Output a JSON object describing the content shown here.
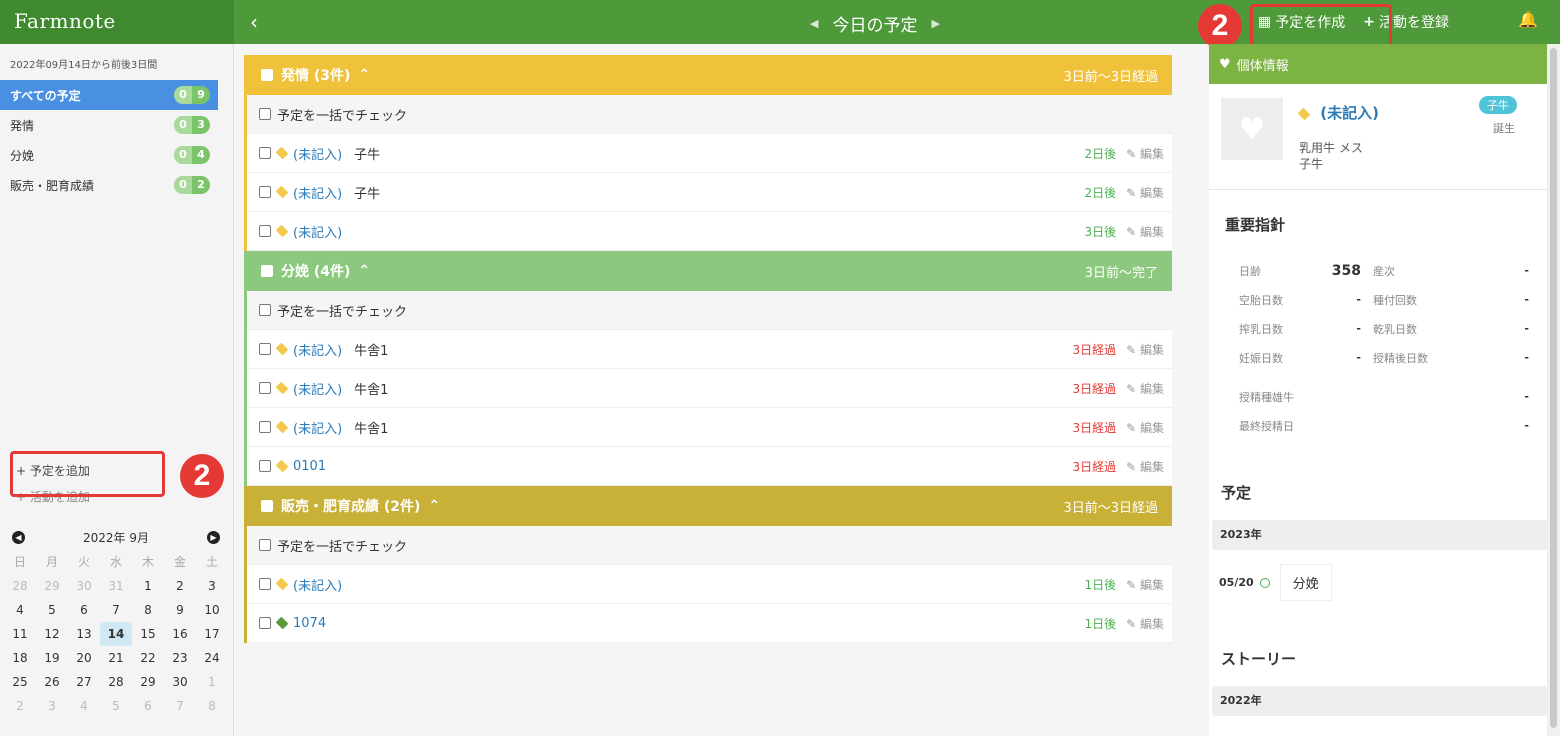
{
  "app": {
    "logo": "Farmnote",
    "back_icon": "chevron-left-icon"
  },
  "header": {
    "title": "今日の予定",
    "create_plan": "予定を作成",
    "register_activity": "活動を登録",
    "marker": "2"
  },
  "sidebar": {
    "range": "2022年09月14日から前後3日間",
    "items": [
      {
        "label": "すべての予定",
        "count": [
          "0",
          "9"
        ],
        "active": true
      },
      {
        "label": "発情",
        "count": [
          "0",
          "3"
        ]
      },
      {
        "label": "分娩",
        "count": [
          "0",
          "4"
        ]
      },
      {
        "label": "販売・肥育成績",
        "count": [
          "0",
          "2"
        ]
      }
    ],
    "add_plan": "+ 予定を追加",
    "add_activity": "+ 活動を追加",
    "marker": "2"
  },
  "calendar": {
    "month": "2022年 9月",
    "dow": [
      "日",
      "月",
      "火",
      "水",
      "木",
      "金",
      "土"
    ],
    "weeks": [
      [
        "28",
        "29",
        "30",
        "31",
        "1",
        "2",
        "3"
      ],
      [
        "4",
        "5",
        "6",
        "7",
        "8",
        "9",
        "10"
      ],
      [
        "11",
        "12",
        "13",
        "14",
        "15",
        "16",
        "17"
      ],
      [
        "18",
        "19",
        "20",
        "21",
        "22",
        "23",
        "24"
      ],
      [
        "25",
        "26",
        "27",
        "28",
        "29",
        "30",
        "1"
      ],
      [
        "2",
        "3",
        "4",
        "5",
        "6",
        "7",
        "8"
      ]
    ],
    "today": "14"
  },
  "groups": [
    {
      "title": "発情 (3件)",
      "range": "3日前〜3日経過",
      "color": "#f0c13a",
      "bulk": "予定を一括でチェック",
      "rows": [
        {
          "id": "(未記入)",
          "note": "子牛",
          "due": "2日後",
          "due_type": "green",
          "tag": "#f2c94c"
        },
        {
          "id": "(未記入)",
          "note": "子牛",
          "due": "2日後",
          "due_type": "green",
          "tag": "#f2c94c"
        },
        {
          "id": "(未記入)",
          "note": "",
          "due": "3日後",
          "due_type": "green",
          "tag": "#f2c94c"
        }
      ]
    },
    {
      "title": "分娩 (4件)",
      "range": "3日前〜完了",
      "color": "#8cc97e",
      "bulk": "予定を一括でチェック",
      "rows": [
        {
          "id": "(未記入)",
          "note": "牛舎1",
          "due": "3日経過",
          "due_type": "red",
          "tag": "#f2c94c"
        },
        {
          "id": "(未記入)",
          "note": "牛舎1",
          "due": "3日経過",
          "due_type": "red",
          "tag": "#f2c94c"
        },
        {
          "id": "(未記入)",
          "note": "牛舎1",
          "due": "3日経過",
          "due_type": "red",
          "tag": "#f2c94c"
        },
        {
          "id": "0101",
          "note": "",
          "due": "3日経過",
          "due_type": "red",
          "tag": "#f2c94c"
        }
      ]
    },
    {
      "title": "販売・肥育成績 (2件)",
      "range": "3日前〜3日経過",
      "color": "#c9b036",
      "bulk": "予定を一括でチェック",
      "rows": [
        {
          "id": "(未記入)",
          "note": "",
          "due": "1日後",
          "due_type": "green",
          "tag": "#f2c94c"
        },
        {
          "id": "1074",
          "note": "",
          "due": "1日後",
          "due_type": "green",
          "tag": "#5b9a3c"
        }
      ]
    }
  ],
  "edit_label": "編集",
  "cow": {
    "panel_title": "個体情報",
    "name": "(未記入)",
    "badge": "子牛",
    "birth": "誕生",
    "breed": "乳用牛 メス",
    "stage": "子牛"
  },
  "indicators": {
    "title": "重要指針",
    "rows": [
      {
        "l1": "日齢",
        "v1": "358",
        "l2": "産次",
        "v2": "-"
      },
      {
        "l1": "空胎日数",
        "v1": "-",
        "l2": "種付回数",
        "v2": "-"
      },
      {
        "l1": "搾乳日数",
        "v1": "-",
        "l2": "乾乳日数",
        "v2": "-"
      },
      {
        "l1": "妊娠日数",
        "v1": "-",
        "l2": "授精後日数",
        "v2": "-"
      }
    ],
    "extra": [
      {
        "l": "授精種雄牛",
        "v": "-"
      },
      {
        "l": "最終授精日",
        "v": "-"
      }
    ]
  },
  "plans": {
    "title": "予定",
    "year": "2023年",
    "date": "05/20",
    "event": "分娩"
  },
  "story": {
    "title": "ストーリー",
    "year": "2022年"
  }
}
